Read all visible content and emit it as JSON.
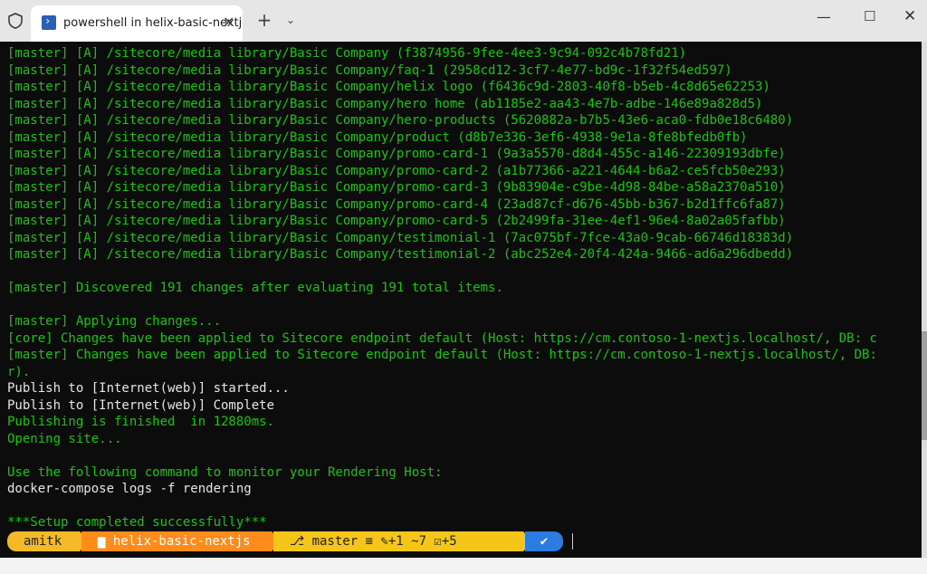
{
  "tab": {
    "title": "powershell in helix-basic-nextj",
    "close": "✕"
  },
  "titlebar": {
    "new_tab": "+",
    "dropdown": "⌄",
    "minimize": "—",
    "maximize": "☐",
    "close": "✕"
  },
  "terminal": {
    "lines": [
      {
        "text": "[master] [A] /sitecore/media library/Basic Company (f3874956-9fee-4ee3-9c94-092c4b78fd21)",
        "color": "green"
      },
      {
        "text": "[master] [A] /sitecore/media library/Basic Company/faq-1 (2958cd12-3cf7-4e77-bd9c-1f32f54ed597)",
        "color": "green"
      },
      {
        "text": "[master] [A] /sitecore/media library/Basic Company/helix logo (f6436c9d-2803-40f8-b5eb-4c8d65e62253)",
        "color": "green"
      },
      {
        "text": "[master] [A] /sitecore/media library/Basic Company/hero home (ab1185e2-aa43-4e7b-adbe-146e89a828d5)",
        "color": "green"
      },
      {
        "text": "[master] [A] /sitecore/media library/Basic Company/hero-products (5620882a-b7b5-43e6-aca0-fdb0e18c6480)",
        "color": "green"
      },
      {
        "text": "[master] [A] /sitecore/media library/Basic Company/product (d8b7e336-3ef6-4938-9e1a-8fe8bfedb0fb)",
        "color": "green"
      },
      {
        "text": "[master] [A] /sitecore/media library/Basic Company/promo-card-1 (9a3a5570-d8d4-455c-a146-22309193dbfe)",
        "color": "green"
      },
      {
        "text": "[master] [A] /sitecore/media library/Basic Company/promo-card-2 (a1b77366-a221-4644-b6a2-ce5fcb50e293)",
        "color": "green"
      },
      {
        "text": "[master] [A] /sitecore/media library/Basic Company/promo-card-3 (9b83904e-c9be-4d98-84be-a58a2370a510)",
        "color": "green"
      },
      {
        "text": "[master] [A] /sitecore/media library/Basic Company/promo-card-4 (23ad87cf-d676-45bb-b367-b2d1ffc6fa87)",
        "color": "green"
      },
      {
        "text": "[master] [A] /sitecore/media library/Basic Company/promo-card-5 (2b2499fa-31ee-4ef1-96e4-8a02a05fafbb)",
        "color": "green"
      },
      {
        "text": "[master] [A] /sitecore/media library/Basic Company/testimonial-1 (7ac075bf-7fce-43a0-9cab-66746d18383d)",
        "color": "green"
      },
      {
        "text": "[master] [A] /sitecore/media library/Basic Company/testimonial-2 (abc252e4-20f4-424a-9466-ad6a296dbedd)",
        "color": "green"
      },
      {
        "text": "",
        "color": "green"
      },
      {
        "text": "[master] Discovered 191 changes after evaluating 191 total items.",
        "color": "green"
      },
      {
        "text": "",
        "color": "green"
      },
      {
        "text": "[master] Applying changes...",
        "color": "green"
      },
      {
        "text": "[core] Changes have been applied to Sitecore endpoint default (Host: https://cm.contoso-1-nextjs.localhost/, DB: c",
        "color": "green"
      },
      {
        "text": "[master] Changes have been applied to Sitecore endpoint default (Host: https://cm.contoso-1-nextjs.localhost/, DB:",
        "color": "green"
      },
      {
        "text": "r).",
        "color": "green"
      },
      {
        "text": "Publish to [Internet(web)] started...",
        "color": "white"
      },
      {
        "text": "Publish to [Internet(web)] Complete",
        "color": "white"
      },
      {
        "text": "Publishing is finished  in 12880ms.",
        "color": "green"
      },
      {
        "text": "Opening site...",
        "color": "green"
      },
      {
        "text": "",
        "color": "green"
      },
      {
        "text": "Use the following command to monitor your Rendering Host:",
        "color": "green"
      },
      {
        "text": "docker-compose logs -f rendering",
        "color": "white"
      },
      {
        "text": "",
        "color": "green"
      },
      {
        "text": "***Setup completed successfully***",
        "color": "green"
      }
    ]
  },
  "prompt": {
    "user": "amitk",
    "folder_icon": "folder-icon",
    "folder": "helix-basic-nextjs",
    "git": "master ≡ ✎+1 ~7 ☑+5",
    "status": "✔"
  },
  "colors": {
    "green": "#16c60c",
    "white": "#e6e6e6",
    "user_bg": "#f5b826",
    "folder_bg": "#ff8c1a",
    "git_bg": "#f5c518",
    "ok_bg": "#2c7be0"
  }
}
